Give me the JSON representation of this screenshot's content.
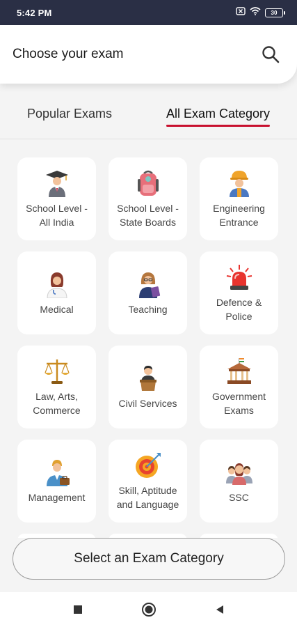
{
  "status_bar": {
    "time": "5:42 PM",
    "battery": "30"
  },
  "header": {
    "title": "Choose your exam"
  },
  "tabs": [
    {
      "label": "Popular Exams",
      "active": false
    },
    {
      "label": "All Exam Category",
      "active": true
    }
  ],
  "categories": [
    {
      "label": "School Level - All India",
      "icon": "graduate-icon"
    },
    {
      "label": "School Level - State Boards",
      "icon": "school-bag-icon"
    },
    {
      "label": "Engineering Entrance",
      "icon": "engineer-icon"
    },
    {
      "label": "Medical",
      "icon": "doctor-icon"
    },
    {
      "label": "Teaching",
      "icon": "teacher-icon"
    },
    {
      "label": "Defence & Police",
      "icon": "siren-icon"
    },
    {
      "label": "Law, Arts, Commerce",
      "icon": "scales-icon"
    },
    {
      "label": "Civil Services",
      "icon": "podium-speaker-icon"
    },
    {
      "label": "Government Exams",
      "icon": "government-building-icon"
    },
    {
      "label": "Management",
      "icon": "manager-icon"
    },
    {
      "label": "Skill, Aptitude and Language",
      "icon": "target-icon"
    },
    {
      "label": "SSC",
      "icon": "group-icon"
    }
  ],
  "select_button": {
    "label": "Select an Exam Category"
  },
  "colors": {
    "status_bar": "#2a2f45",
    "accent": "#c8102e",
    "background": "#f4f4f4"
  }
}
